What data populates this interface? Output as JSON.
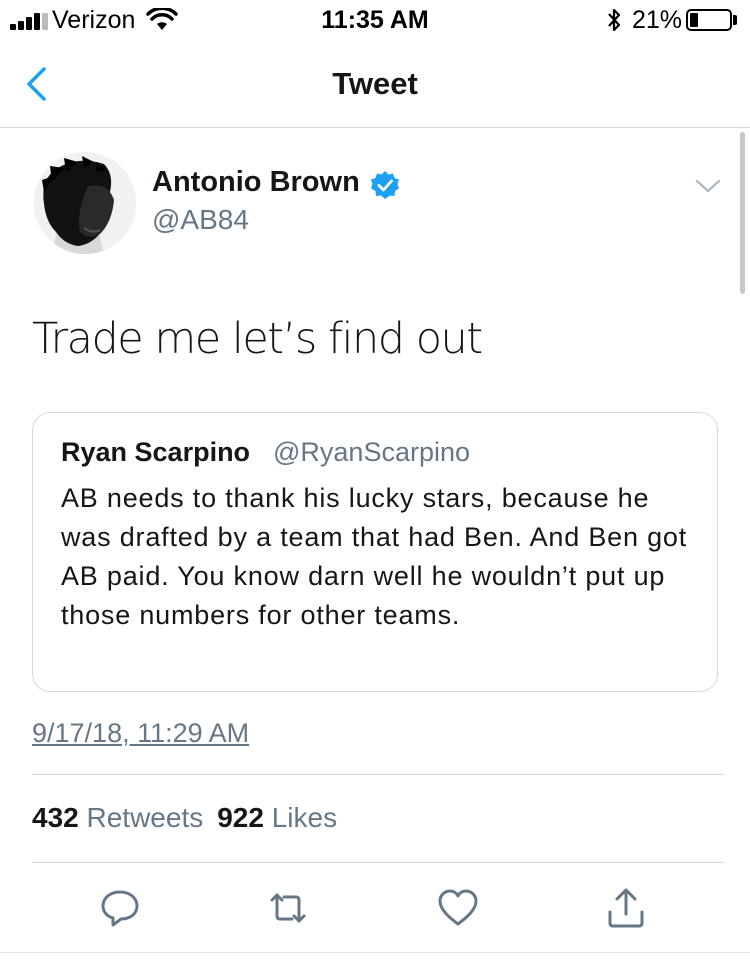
{
  "status_bar": {
    "carrier": "Verizon",
    "time": "11:35 AM",
    "battery_percent": "21%",
    "battery_level": 0.21
  },
  "nav": {
    "title": "Tweet"
  },
  "tweet": {
    "author_name": "Antonio Brown",
    "author_handle": "@AB84",
    "verified": true,
    "text": "Trade me let’s find out",
    "timestamp": "9/17/18, 11:29 AM"
  },
  "quoted_tweet": {
    "author_name": "Ryan Scarpino",
    "author_handle": "@RyanScarpino",
    "text": "AB needs to thank his lucky stars, because he was drafted by a team that had Ben. And Ben got AB paid. You know darn well he wouldn’t put up those numbers for other teams."
  },
  "stats": {
    "retweets_count": "432",
    "retweets_label": "Retweets",
    "likes_count": "922",
    "likes_label": "Likes"
  },
  "icons": {
    "back": "chevron-left-icon",
    "verified": "verified-badge-icon",
    "caret": "chevron-down-icon",
    "reply": "reply-icon",
    "retweet": "retweet-icon",
    "like": "heart-icon",
    "share": "share-icon"
  },
  "colors": {
    "accent": "#1da1f2",
    "text_primary": "#14171a",
    "text_secondary": "#657786",
    "divider": "#d6d9dc"
  }
}
